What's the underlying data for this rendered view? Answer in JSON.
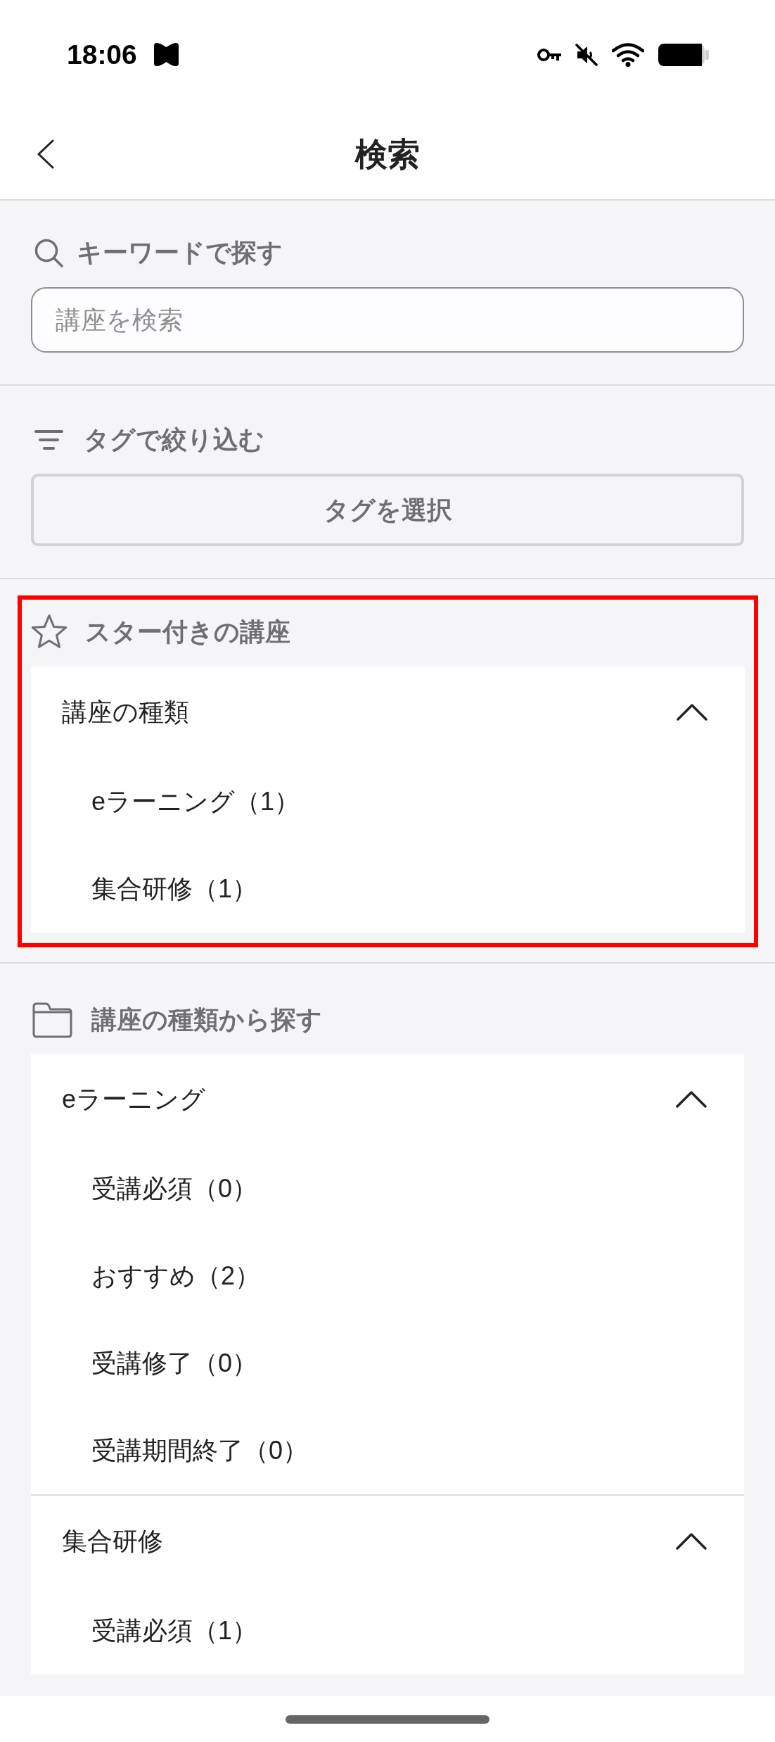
{
  "status_bar": {
    "time": "18:06"
  },
  "header": {
    "title": "検索"
  },
  "keyword_section": {
    "title": "キーワードで探す",
    "search": {
      "placeholder": "講座を検索"
    }
  },
  "tag_section": {
    "title": "タグで絞り込む",
    "button": "タグを選択"
  },
  "starred_section": {
    "title": "スター付きの講座",
    "highlighted": true,
    "groups": [
      {
        "label": "講座の種類",
        "expanded": true,
        "items": [
          "eラーニング（1）",
          "集合研修（1）"
        ]
      }
    ]
  },
  "category_section": {
    "title": "講座の種類から探す",
    "groups": [
      {
        "label": "eラーニング",
        "expanded": true,
        "items": [
          "受講必須（0）",
          "おすすめ（2）",
          "受講修了（0）",
          "受講期間終了（0）"
        ]
      },
      {
        "label": "集合研修",
        "expanded": true,
        "items": [
          "受講必須（1）"
        ]
      }
    ]
  }
}
